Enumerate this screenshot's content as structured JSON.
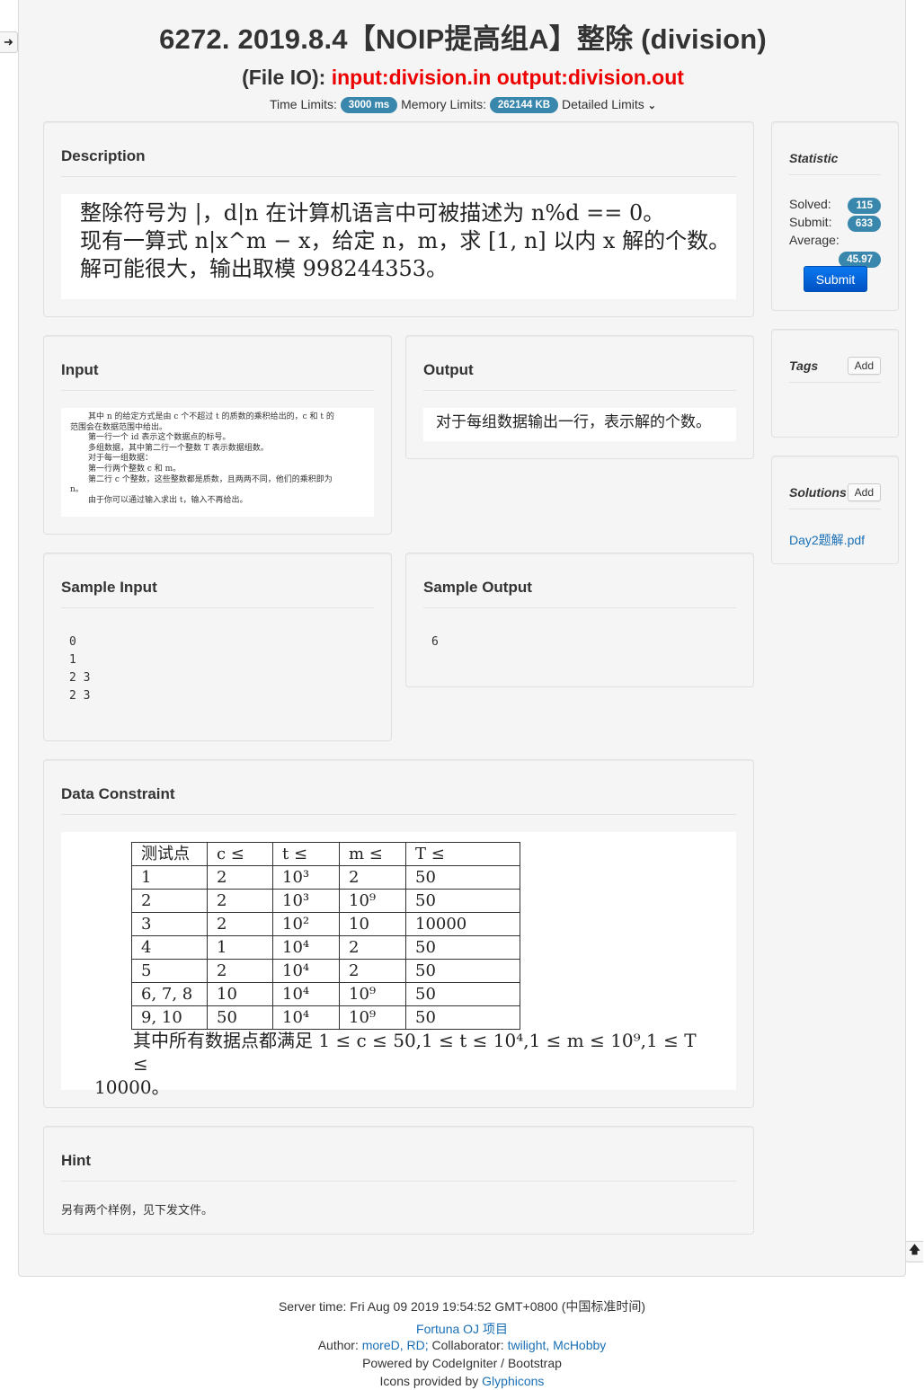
{
  "problem": {
    "title": "6272. 2019.8.4【NOIP提高组A】整除 (division)",
    "file_io_label": "(File IO):",
    "file_io_value": "input:division.in output:division.out",
    "time_limits_label": "Time Limits:",
    "time_limit": "3000 ms",
    "memory_limits_label": "Memory Limits:",
    "memory_limit": "262144 KB",
    "detailed_limits": "Detailed Limits"
  },
  "description": {
    "heading": "Description",
    "line1": "整除符号为 |，d|n 在计算机语言中可被描述为 n%d == 0。",
    "line2": "现有一算式 n|x^m − x，给定 n，m，求 [1, n] 以内 x 解的个数。",
    "line3": "解可能很大，输出取模 998244353。"
  },
  "input": {
    "heading": "Input",
    "lines": [
      "其中 n 的给定方式是由 c 个不超过 t 的质数的乘积给出的，c 和 t 的",
      "范围会在数据范围中给出。",
      "第一行一个 id 表示这个数据点的标号。",
      "多组数据，其中第二行一个整数 T 表示数据组数。",
      "对于每一组数据：",
      "第一行两个整数 c 和 m。",
      "第二行 c 个整数，这些整数都是质数，且两两不同，他们的乘积即为",
      "n。",
      "由于你可以通过输入求出 t，输入不再给出。"
    ]
  },
  "output": {
    "heading": "Output",
    "text": "对于每组数据输出一行，表示解的个数。"
  },
  "sample_input": {
    "heading": "Sample Input",
    "text": "0\n1\n2 3\n2 3"
  },
  "sample_output": {
    "heading": "Sample Output",
    "text": "6"
  },
  "data_constraint": {
    "heading": "Data Constraint",
    "header": [
      "测试点",
      "c ≤",
      "t ≤",
      "m ≤",
      "T ≤"
    ],
    "rows": [
      [
        "1",
        "2",
        "10³",
        "2",
        "50"
      ],
      [
        "2",
        "2",
        "10³",
        "10⁹",
        "50"
      ],
      [
        "3",
        "2",
        "10²",
        "10",
        "10000"
      ],
      [
        "4",
        "1",
        "10⁴",
        "2",
        "50"
      ],
      [
        "5",
        "2",
        "10⁴",
        "2",
        "50"
      ],
      [
        "6, 7, 8",
        "10",
        "10⁴",
        "10⁹",
        "50"
      ],
      [
        "9, 10",
        "50",
        "10⁴",
        "10⁹",
        "50"
      ]
    ],
    "note_line1": "其中所有数据点都满足 1 ≤ c ≤ 50,1 ≤ t ≤ 10⁴,1 ≤ m ≤ 10⁹,1 ≤ T ≤",
    "note_line2": "10000。"
  },
  "hint": {
    "heading": "Hint",
    "text": "另有两个样例，见下发文件。"
  },
  "sidebar": {
    "statistic_heading": "Statistic",
    "solved_label": "Solved:",
    "solved": "115",
    "submit_label": "Submit:",
    "submit": "633",
    "average_label": "Average:",
    "average": "45.97",
    "submit_button": "Submit",
    "tags_heading": "Tags",
    "add_label": "Add",
    "solutions_heading": "Solutions",
    "solution_file": "Day2题解.pdf"
  },
  "footer": {
    "server_time": "Server time: Fri Aug 09 2019 19:54:52 GMT+0800 (中国标准时间)",
    "project_link": "Fortuna OJ 项目",
    "author_label": "Author:",
    "author_links": "moreD, RD;",
    "collaborator_label": "Collaborator:",
    "collaborator_link1": "twilight,",
    "collaborator_link2": "McHobby",
    "powered_by": "Powered by CodeIgniter / Bootstrap",
    "icons_label": "Icons provided by",
    "icons_link": "Glyphicons"
  },
  "icons": {
    "side_left": "arrow-right-icon",
    "side_right": "arrow-up-icon",
    "detailed_limits": "chevron-down-icon"
  }
}
